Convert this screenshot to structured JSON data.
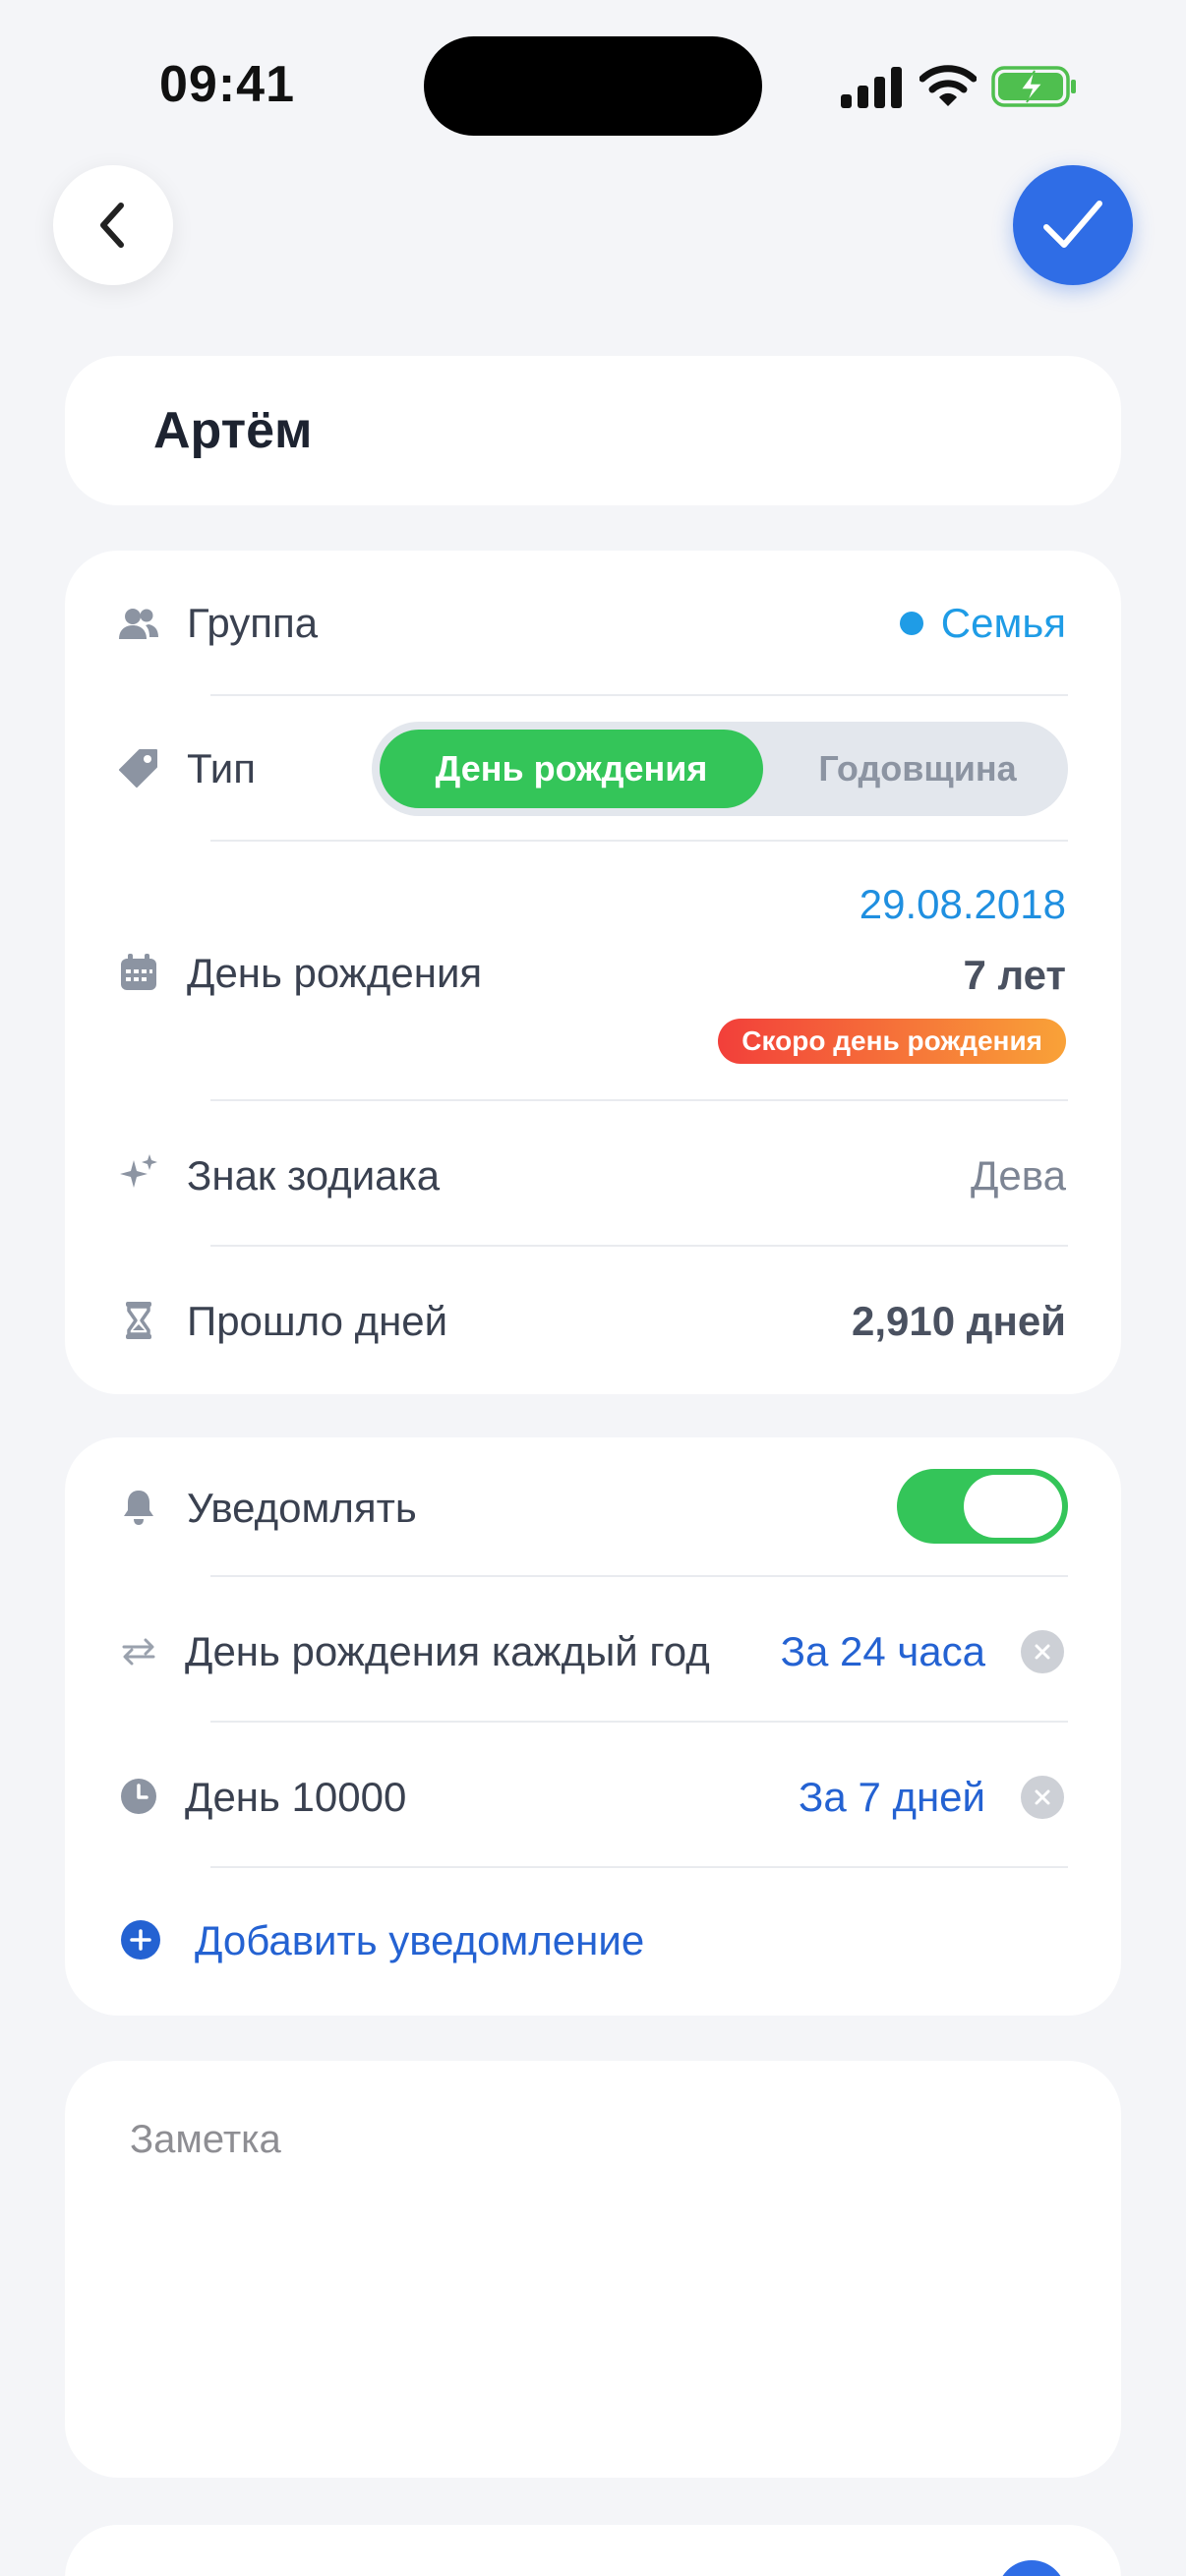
{
  "status_bar": {
    "time": "09:41",
    "icons": [
      "cellular-signal-icon",
      "wifi-icon",
      "battery-charging-icon"
    ]
  },
  "nav": {
    "back_icon": "chevron-left-icon",
    "done_icon": "checkmark-icon"
  },
  "contact": {
    "name": "Артём"
  },
  "details": {
    "group": {
      "label": "Группа",
      "value": "Семья",
      "color": "#1f9ce6",
      "icon": "people-icon"
    },
    "type": {
      "label": "Тип",
      "options": [
        "День рождения",
        "Годовщина"
      ],
      "selected": "День рождения",
      "icon": "tag-icon"
    },
    "birthday": {
      "label": "День рождения",
      "date": "29.08.2018",
      "age": "7 лет",
      "badge": "Скоро день рождения",
      "icon": "calendar-icon"
    },
    "zodiac": {
      "label": "Знак зодиака",
      "value": "Дева",
      "icon": "sparkles-icon"
    },
    "days_passed": {
      "label": "Прошло дней",
      "value": "2,910 дней",
      "icon": "hourglass-icon"
    }
  },
  "notifications": {
    "toggle_label": "Уведомлять",
    "enabled": true,
    "reminders": [
      {
        "label": "День рождения каждый год",
        "value": "За 24 часа",
        "icon": "repeat-icon"
      },
      {
        "label": "День 10000",
        "value": "За 7 дней",
        "icon": "clock-icon"
      }
    ],
    "add_label": "Добавить уведомление"
  },
  "note": {
    "placeholder": "Заметка"
  },
  "colors": {
    "accent": "#2f6de6",
    "toggle_on": "#34c559",
    "link": "#2462d2",
    "badge_gradient": [
      "#f23f3a",
      "#f9a238"
    ]
  }
}
